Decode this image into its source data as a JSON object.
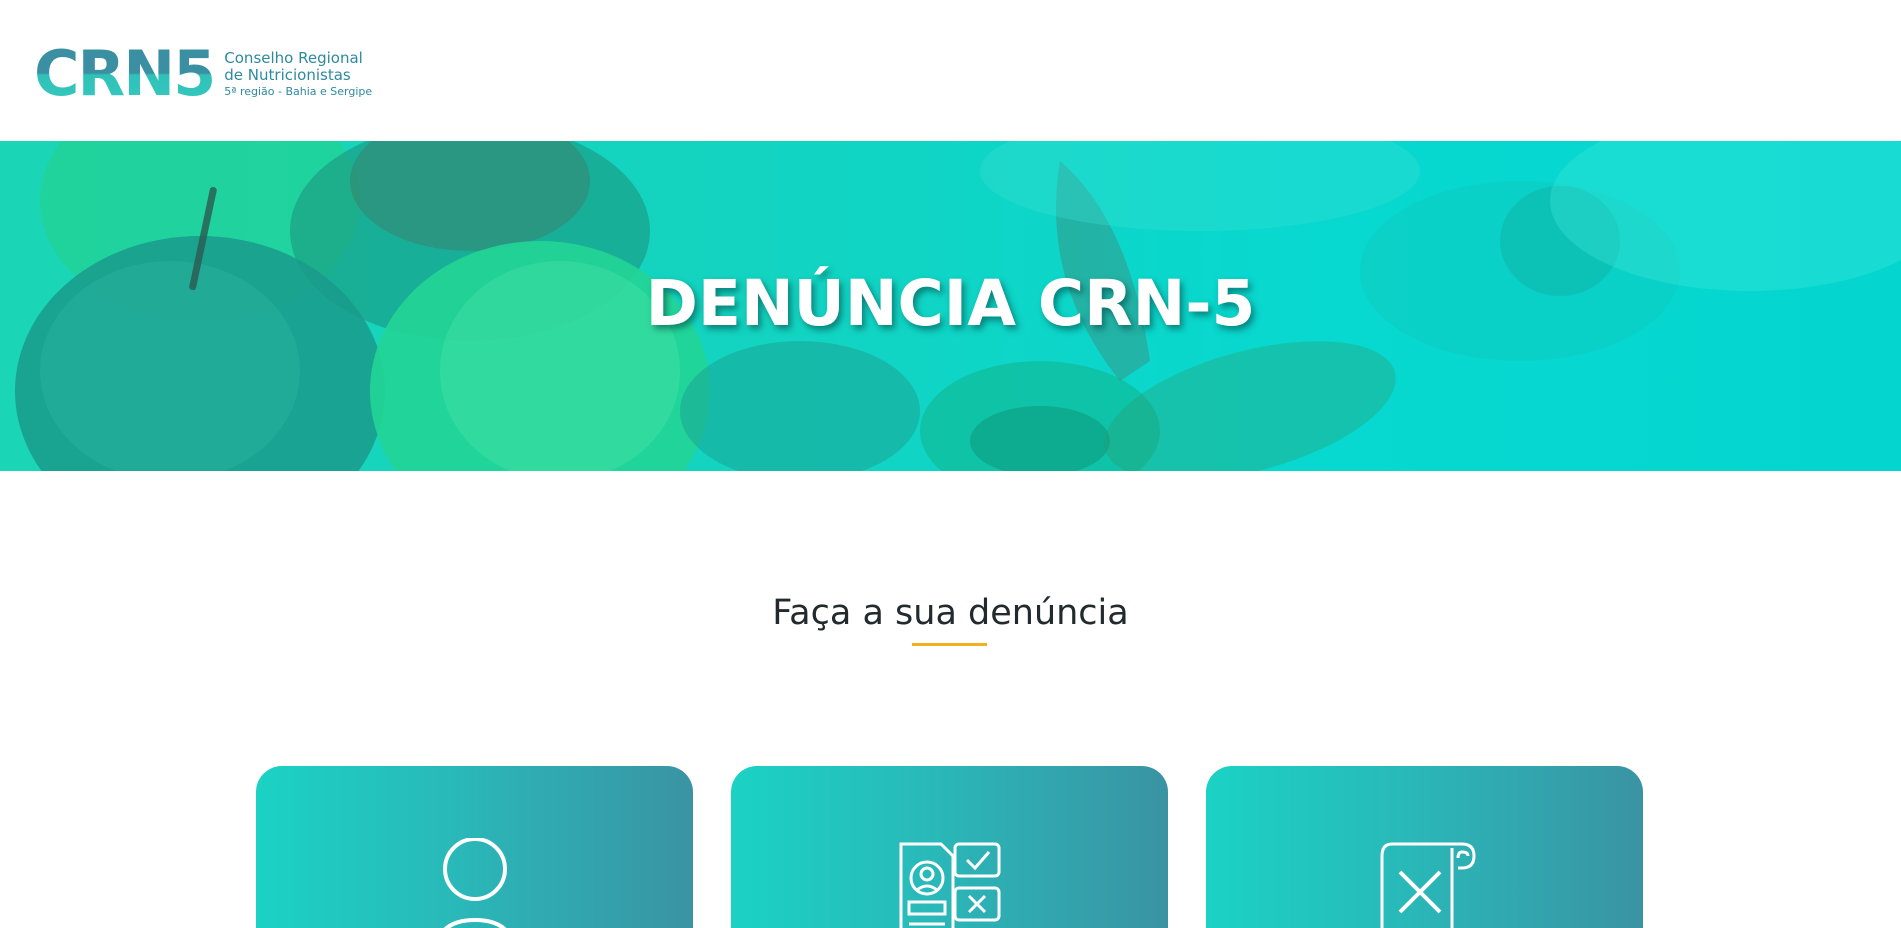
{
  "header": {
    "logo": {
      "mark": "CRN5",
      "line1": "Conselho Regional",
      "line2": "de Nutricionistas",
      "line3": "5ª região - Bahia e Sergipe"
    }
  },
  "hero": {
    "title": "DENÚNCIA CRN-5"
  },
  "section": {
    "title": "Faça a sua denúncia"
  },
  "cards": [
    {
      "icon": "person-icon"
    },
    {
      "icon": "document-check-icon"
    },
    {
      "icon": "scroll-x-icon"
    }
  ],
  "colors": {
    "brand_teal": "#2e8aa0",
    "brand_cyan": "#36c7be",
    "accent_yellow": "#f2b01e",
    "hero_overlay": "#07d8d0",
    "card_gradient_start": "#1bd2c4",
    "card_gradient_end": "#3a93a3"
  }
}
